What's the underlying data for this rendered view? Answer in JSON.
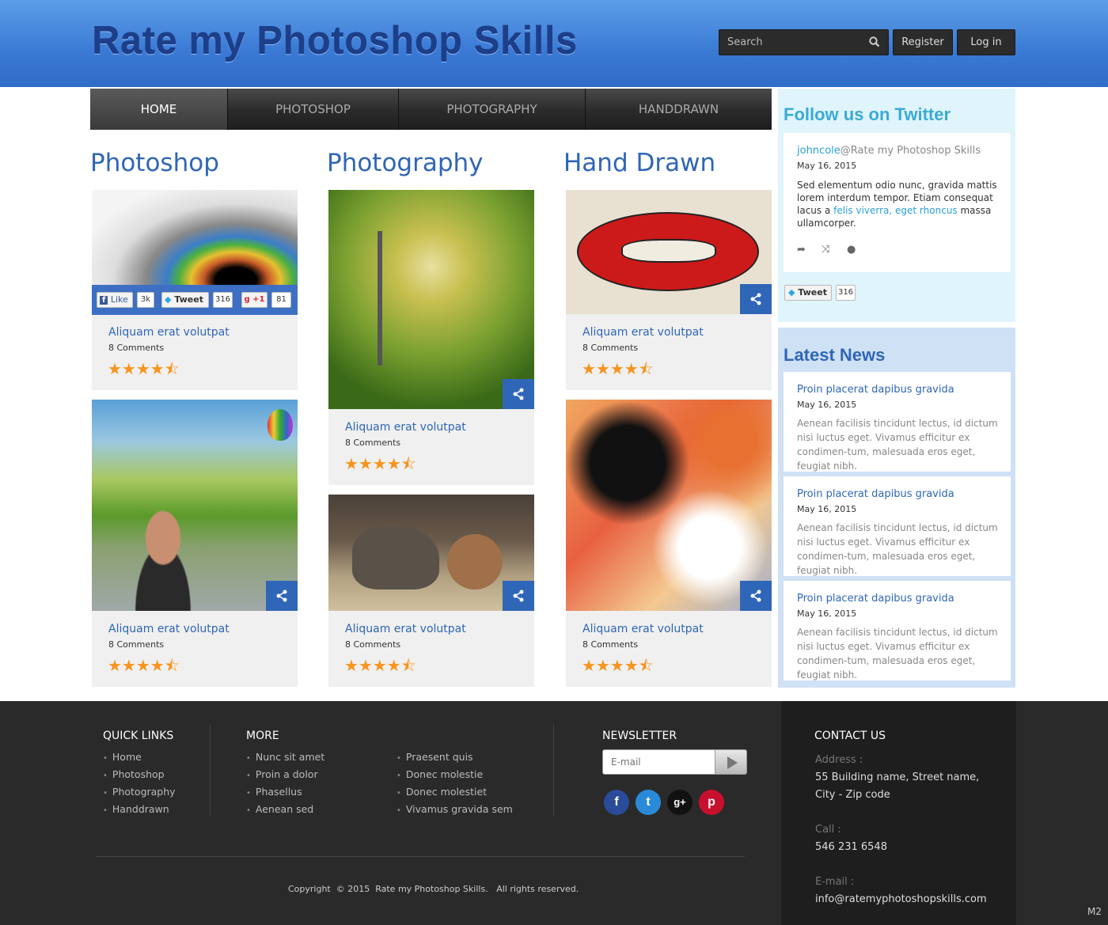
{
  "header": {
    "site_title": "Rate my Photoshop Skills",
    "search_placeholder": "Search",
    "register_label": "Register",
    "login_label": "Log in"
  },
  "nav": {
    "items": [
      {
        "label": "HOME",
        "active": true
      },
      {
        "label": "PHOTOSHOP"
      },
      {
        "label": "PHOTOGRAPHY"
      },
      {
        "label": "HANDDRAWN"
      }
    ]
  },
  "columns": [
    {
      "title": "Photoshop"
    },
    {
      "title": "Photography"
    },
    {
      "title": "Hand Drawn"
    }
  ],
  "card": {
    "title": "Aliquam erat volutpat",
    "comments": "8 Comments",
    "rating": 4.5
  },
  "social_bar": {
    "like_label": "Like",
    "like_count": "3k",
    "tweet_label": "Tweet",
    "tweet_count": "316",
    "plus_label": "+1",
    "plus_count": "81"
  },
  "twitter": {
    "title": "Follow us on Twitter",
    "user": "johncole",
    "handle": "@Rate my Photoshop Skills",
    "date": "May 16, 2015",
    "text_before": "Sed elementum odio nunc, gravida mattis lorem interdum tempor. Etiam consequat lacus a ",
    "link_text": "felis viverra, eget rhoncus",
    "text_after": " massa ullamcorper.",
    "tweet_label": "Tweet",
    "tweet_count": "316"
  },
  "news": {
    "title": "Latest News",
    "items": [
      {
        "title": "Proin placerat dapibus gravida",
        "date": "May 16, 2015",
        "body": "Aenean facilisis tincidunt lectus, id dictum nisi luctus eget. Vivamus efficitur ex condimen-tum, malesuada eros eget, feugiat nibh."
      },
      {
        "title": "Proin placerat dapibus gravida",
        "date": "May 16, 2015",
        "body": "Aenean facilisis tincidunt lectus, id dictum nisi luctus eget. Vivamus efficitur ex condimen-tum, malesuada eros eget, feugiat nibh."
      },
      {
        "title": "Proin placerat dapibus gravida",
        "date": "May 16, 2015",
        "body": "Aenean facilisis tincidunt lectus, id dictum nisi luctus eget. Vivamus efficitur ex condimen-tum, malesuada eros eget, feugiat nibh."
      }
    ]
  },
  "footer": {
    "quick_links_title": "QUICK LINKS",
    "quick_links": [
      "Home",
      "Photoshop",
      "Photography",
      "Handdrawn"
    ],
    "more_title": "MORE",
    "more_col1": [
      "Nunc sit amet",
      "Proin a dolor",
      "Phasellus",
      "Aenean sed"
    ],
    "more_col2": [
      "Praesent quis",
      "Donec molestie",
      "Donec molestiet",
      "Vivamus gravida sem"
    ],
    "newsletter_title": "NEWSLETTER",
    "email_placeholder": "E-mail",
    "copyright": "Copyright  © 2015  Rate my Photoshop Skills.   All rights reserved.",
    "contact_title": "CONTACT US",
    "address_label": "Address :",
    "address_line1": "55 Building name, Street name,",
    "address_line2": "City - Zip code",
    "call_label": "Call :",
    "call_value": "546 231 6548",
    "email_label": "E-mail :",
    "email_value": "info@ratemyphotoshopskills.com",
    "corner_tag": "M2"
  },
  "colors": {
    "accent": "#2f66b8",
    "star": "#f7941d",
    "header_blue": "#3a79d4"
  }
}
